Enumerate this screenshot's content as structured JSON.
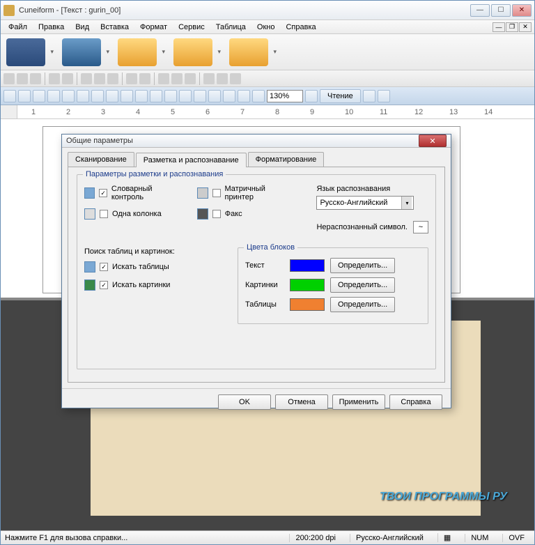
{
  "window": {
    "title": "Cuneiform - [Текст : gurin_00]"
  },
  "menu": {
    "items": [
      "Файл",
      "Правка",
      "Вид",
      "Вставка",
      "Формат",
      "Сервис",
      "Таблица",
      "Окно",
      "Справка"
    ]
  },
  "format_toolbar": {
    "zoom": "130%",
    "read_button": "Чтение"
  },
  "ruler": {
    "marks": [
      "1",
      "2",
      "3",
      "4",
      "5",
      "6",
      "7",
      "8",
      "9",
      "10",
      "11",
      "12",
      "13",
      "14"
    ]
  },
  "dialog": {
    "title": "Общие параметры",
    "tabs": [
      "Сканирование",
      "Разметка и распознавание",
      "Форматирование"
    ],
    "active_tab": 1,
    "group_params": "Параметры разметки и распознавания",
    "dict_check": "Словарный контроль",
    "one_column": "Одна колонка",
    "dot_matrix": "Матричный принтер",
    "fax": "Факс",
    "lang_label": "Язык распознавания",
    "lang_value": "Русско-Английский",
    "unrec_label": "Нераспознанный символ.",
    "unrec_char": "~",
    "search_label": "Поиск таблиц и картинок:",
    "search_tables": "Искать таблицы",
    "search_pictures": "Искать картинки",
    "colors_group": "Цвета блоков",
    "color_text": "Текст",
    "color_pics": "Картинки",
    "color_tables": "Таблицы",
    "define_btn": "Определить...",
    "colors": {
      "text": "#0000ff",
      "pictures": "#00d000",
      "tables": "#f08030"
    },
    "ok": "OK",
    "cancel": "Отмена",
    "apply": "Применить",
    "help": "Справка"
  },
  "statusbar": {
    "hint": "Нажмите F1 для вызова справки...",
    "dpi": "200:200 dpi",
    "lang": "Русско-Английский",
    "num": "NUM",
    "ovf": "OVF"
  },
  "watermark": "ТВОИ ПРОГРАММЫ РУ"
}
